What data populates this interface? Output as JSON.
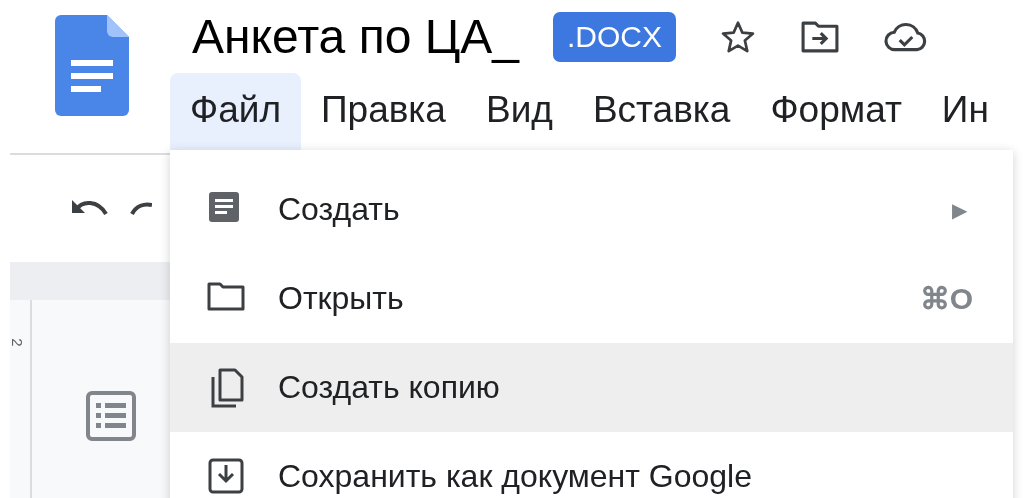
{
  "document": {
    "title": "Анкета по ЦА_",
    "file_type_badge": ".DOCX"
  },
  "menu_bar": [
    {
      "label": "Файл",
      "selected": true
    },
    {
      "label": "Правка",
      "selected": false
    },
    {
      "label": "Вид",
      "selected": false
    },
    {
      "label": "Вставка",
      "selected": false
    },
    {
      "label": "Формат",
      "selected": false
    },
    {
      "label": "Ин",
      "selected": false
    }
  ],
  "ruler_label": "2",
  "file_menu": {
    "items": [
      {
        "label": "Создать",
        "submenu_arrow": "▶",
        "selected": false
      },
      {
        "label": "Открыть",
        "shortcut": "⌘O",
        "selected": false
      },
      {
        "label": "Создать копию",
        "selected": true
      },
      {
        "label": "Сохранить как документ Google",
        "selected": false
      }
    ]
  }
}
